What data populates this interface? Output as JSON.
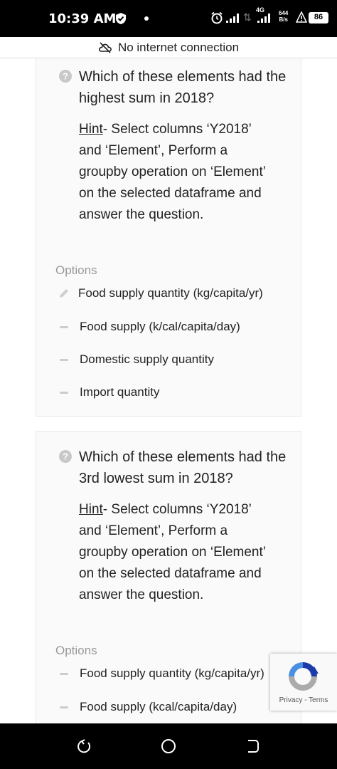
{
  "status_bar": {
    "time": "10:39 AM",
    "network_label": "4G",
    "speed_value": "644",
    "speed_unit": "B/s",
    "battery": "86"
  },
  "offline_banner": {
    "text": "No internet connection"
  },
  "questions": [
    {
      "question": "Which of these elements had the highest sum in 2018?",
      "hint_label": "Hint",
      "hint_text": "- Select columns ‘Y2018’ and ‘Element’, Perform a groupby operation on ‘Element’ on the selected dataframe and answer the question.",
      "options_label": "Options",
      "options": [
        "Food supply quantity (kg/capita/yr)",
        "Food supply (k/cal/capita/day)",
        "Domestic supply quantity",
        "Import quantity"
      ]
    },
    {
      "question": "Which of these elements had the 3rd lowest sum in 2018?",
      "hint_label": "Hint",
      "hint_text": "- Select columns ‘Y2018’ and ‘Element’, Perform a groupby operation on ‘Element’ on the selected dataframe and answer the question.",
      "options_label": "Options",
      "options": [
        "Food supply quantity (kg/capita/yr)",
        "Food supply (kcal/capita/day)"
      ]
    }
  ],
  "recaptcha": {
    "privacy": "Privacy",
    "separator": " - ",
    "terms": "Terms"
  },
  "icons": {
    "question": "help-circle-icon",
    "pencil": "pencil-icon",
    "option_dash": "dash-icon"
  }
}
